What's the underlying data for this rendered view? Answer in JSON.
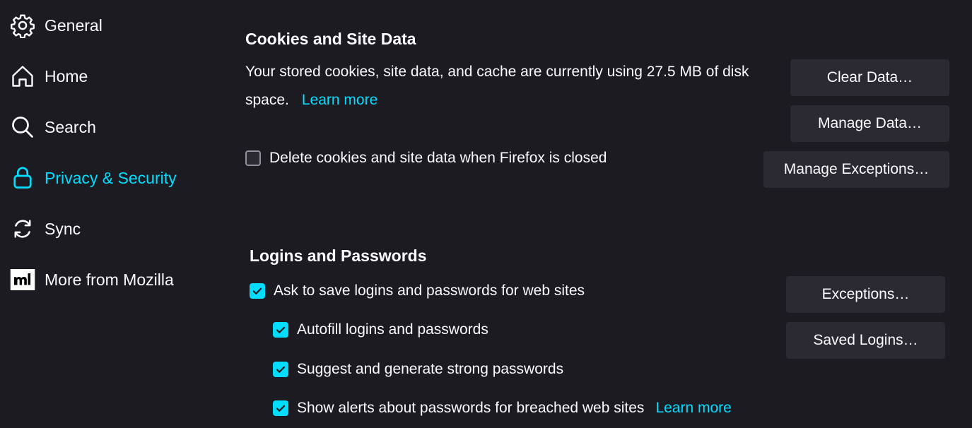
{
  "sidebar": {
    "items": [
      {
        "label": "General",
        "icon": "gear-icon"
      },
      {
        "label": "Home",
        "icon": "home-icon"
      },
      {
        "label": "Search",
        "icon": "search-icon"
      },
      {
        "label": "Privacy & Security",
        "icon": "lock-icon",
        "active": true
      },
      {
        "label": "Sync",
        "icon": "sync-icon"
      },
      {
        "label": "More from Mozilla",
        "icon": "mozilla-icon"
      }
    ]
  },
  "cookies": {
    "title": "Cookies and Site Data",
    "description": "Your stored cookies, site data, and cache are currently using 27.5 MB of disk space.",
    "learn_more": "Learn more",
    "delete_on_close": {
      "label": "Delete cookies and site data when Firefox is closed",
      "checked": false
    },
    "buttons": {
      "clear": "Clear Data…",
      "manage": "Manage Data…",
      "exceptions": "Manage Exceptions…"
    }
  },
  "logins": {
    "title": "Logins and Passwords",
    "ask_to_save": {
      "label": "Ask to save logins and passwords for web sites",
      "checked": true
    },
    "autofill": {
      "label": "Autofill logins and passwords",
      "checked": true
    },
    "suggest": {
      "label": "Suggest and generate strong passwords",
      "checked": true
    },
    "alerts": {
      "label": "Show alerts about passwords for breached web sites",
      "checked": true
    },
    "learn_more": "Learn more",
    "buttons": {
      "exceptions": "Exceptions…",
      "saved_logins": "Saved Logins…"
    }
  },
  "colors": {
    "background": "#1c1b22",
    "accent": "#00ddff",
    "button": "#2b2a33",
    "text": "#fbfbfe"
  }
}
